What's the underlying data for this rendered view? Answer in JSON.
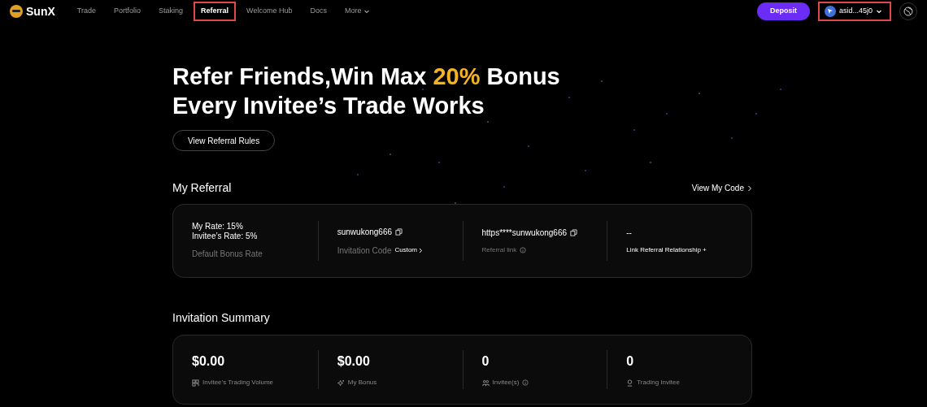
{
  "brand": "SunX",
  "nav": [
    {
      "label": "Trade",
      "selected": false,
      "highlighted": false
    },
    {
      "label": "Portfolio",
      "selected": false,
      "highlighted": false
    },
    {
      "label": "Staking",
      "selected": false,
      "highlighted": false
    },
    {
      "label": "Referral",
      "selected": true,
      "highlighted": true
    },
    {
      "label": "Welcome Hub",
      "selected": false,
      "highlighted": false
    },
    {
      "label": "Docs",
      "selected": false,
      "highlighted": false
    },
    {
      "label": "More",
      "selected": false,
      "highlighted": false,
      "dropdown": true
    }
  ],
  "deposit": "Deposit",
  "wallet": {
    "label": "asid...45j0",
    "highlighted": true
  },
  "hero": {
    "line1_before": "Refer Friends,Win Max ",
    "line1_accent": "20%",
    "line1_after": " Bonus",
    "line2": "Every Invitee’s Trade Works",
    "button": "View Referral Rules"
  },
  "my_referral": {
    "title": "My Referral",
    "link": "View My Code",
    "items": [
      {
        "kind": "rates",
        "lines": [
          "My Rate: 15%",
          "Invitee’s Rate: 5%"
        ],
        "label": "Default Bonus Rate"
      },
      {
        "kind": "code",
        "value": "sunwukong666",
        "label": "Invitation Code",
        "action": "Custom"
      },
      {
        "kind": "link",
        "value": "https****sunwukong666",
        "label": "Referral link"
      },
      {
        "kind": "relation",
        "value": "--",
        "label": "Link Referral Relationship +"
      }
    ]
  },
  "summary": {
    "title": "Invitation Summary",
    "items": [
      {
        "kind": "volume",
        "value": "$0.00",
        "label": "Invitee’s Trading Volume",
        "info": false
      },
      {
        "kind": "bonus",
        "value": "$0.00",
        "label": "My Bonus",
        "info": false
      },
      {
        "kind": "people",
        "value": "0",
        "label": "Invitee(s)",
        "info": true
      },
      {
        "kind": "person",
        "value": "0",
        "label": "Trading Invitee",
        "info": false
      }
    ]
  }
}
